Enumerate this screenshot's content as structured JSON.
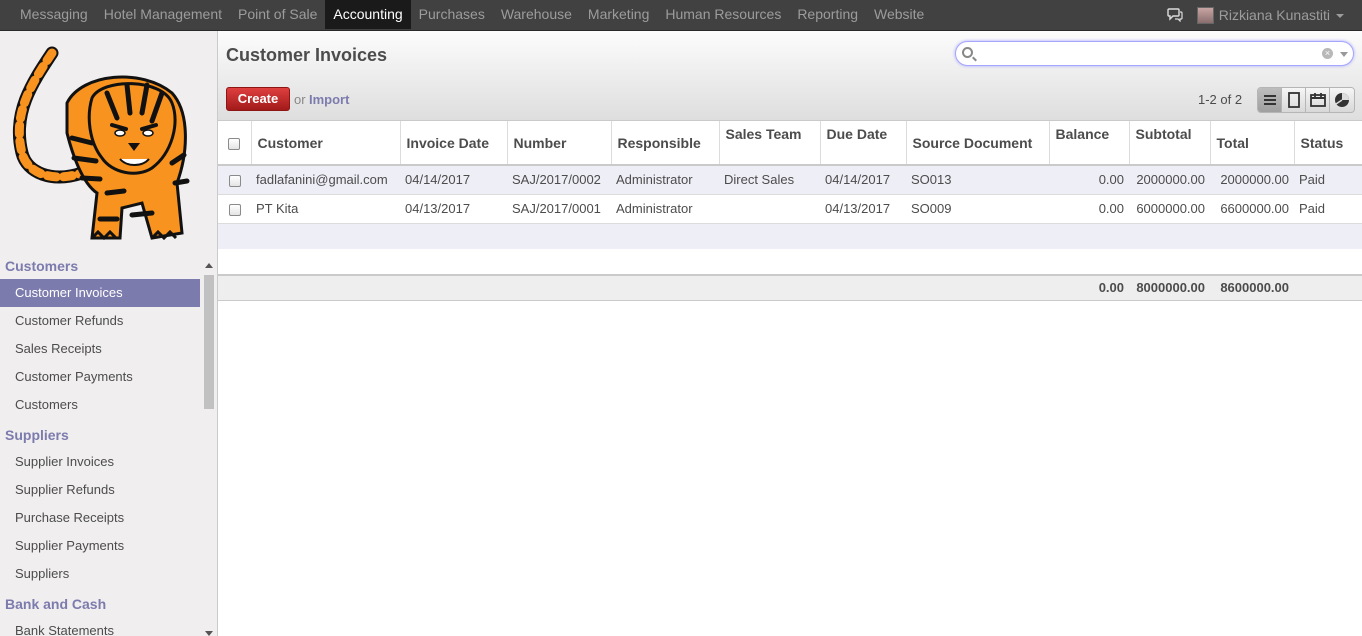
{
  "topbar": {
    "menu": [
      "Messaging",
      "Hotel Management",
      "Point of Sale",
      "Accounting",
      "Purchases",
      "Warehouse",
      "Marketing",
      "Human Resources",
      "Reporting",
      "Website"
    ],
    "active": "Accounting",
    "user_name": "Rizkiana Kunastiti"
  },
  "sidebar": {
    "sections": [
      {
        "title": "Customers",
        "items": [
          "Customer Invoices",
          "Customer Refunds",
          "Sales Receipts",
          "Customer Payments",
          "Customers"
        ]
      },
      {
        "title": "Suppliers",
        "items": [
          "Supplier Invoices",
          "Supplier Refunds",
          "Purchase Receipts",
          "Supplier Payments",
          "Suppliers"
        ]
      },
      {
        "title": "Bank and Cash",
        "items": [
          "Bank Statements"
        ]
      }
    ],
    "active_item": "Customer Invoices"
  },
  "main": {
    "title": "Customer Invoices",
    "search": {
      "value": "",
      "placeholder": ""
    },
    "create_label": "Create",
    "or_label": "or",
    "import_label": "Import",
    "pager": "1-2 of 2",
    "view_icons": [
      "list-view-icon",
      "form-view-icon",
      "calendar-view-icon",
      "graph-view-icon"
    ]
  },
  "table": {
    "columns": [
      "Customer",
      "Invoice Date",
      "Number",
      "Responsible",
      "Sales Team",
      "Due Date",
      "Source Document",
      "Balance",
      "Subtotal",
      "Total",
      "Status"
    ],
    "rows": [
      [
        "fadlafanini@gmail.com",
        "04/14/2017",
        "SAJ/2017/0002",
        "Administrator",
        "Direct Sales",
        "04/14/2017",
        "SO013",
        "0.00",
        "2000000.00",
        "2000000.00",
        "Paid"
      ],
      [
        "PT Kita",
        "04/13/2017",
        "SAJ/2017/0001",
        "Administrator",
        "",
        "04/13/2017",
        "SO009",
        "0.00",
        "6000000.00",
        "6600000.00",
        "Paid"
      ]
    ],
    "totals": {
      "balance": "0.00",
      "subtotal": "8000000.00",
      "total": "8600000.00"
    }
  },
  "colors": {
    "topbar": "#414141",
    "accent": "#7c7bad",
    "create": "#c62828"
  }
}
